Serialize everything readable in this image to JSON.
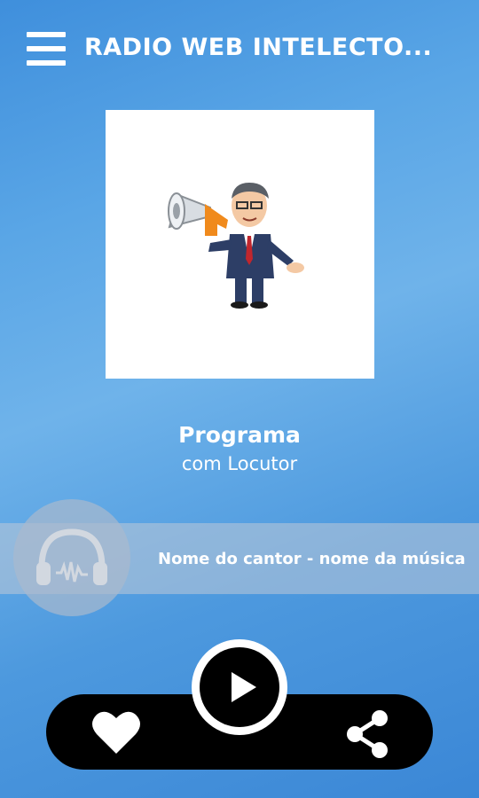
{
  "app": {
    "title": "RADIO WEB INTELECTO..."
  },
  "header": {
    "menu_icon": "hamburger-menu-icon"
  },
  "cover": {
    "image": "megaphone-businessman-illustration"
  },
  "program": {
    "title": "Programa",
    "subtitle": "com Locutor"
  },
  "now_playing": {
    "track": "Nome do cantor - nome da música",
    "icon": "headphones-icon"
  },
  "controls": {
    "play_icon": "play-icon",
    "favorite_icon": "heart-icon",
    "share_icon": "share-icon"
  },
  "colors": {
    "background": "#4d99de",
    "bar": "#000000",
    "text": "#ffffff"
  }
}
